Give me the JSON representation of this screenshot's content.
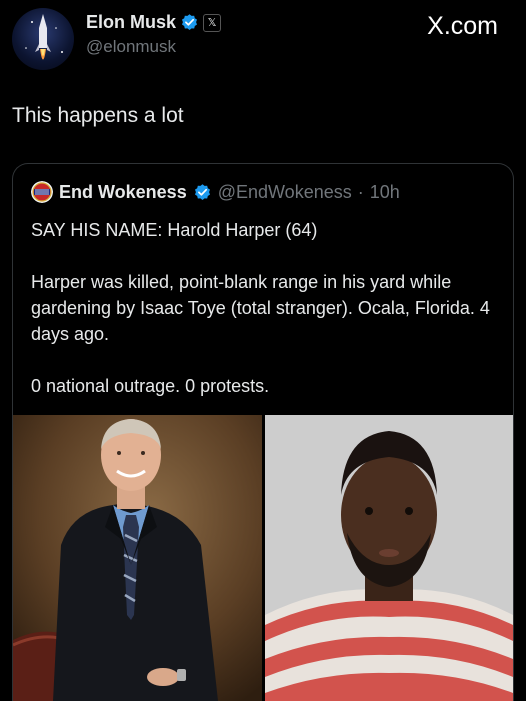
{
  "tweet": {
    "author_name": "Elon Musk",
    "author_handle": "@elonmusk",
    "text": "This happens a lot"
  },
  "brand": {
    "label": "X.com"
  },
  "icons": {
    "verified": "verified-badge-icon",
    "affiliate": "x-affiliate-badge-icon",
    "affiliate_glyph": "𝕏"
  },
  "colors": {
    "background": "#000000",
    "text": "#e7e9ea",
    "secondary_text": "#71767b",
    "verified_blue": "#1d9bf0",
    "border": "#2f3336"
  },
  "quote": {
    "author_name": "End Wokeness",
    "author_handle": "@EndWokeness",
    "separator": "·",
    "time": "10h",
    "line1": "SAY HIS NAME: Harold Harper (64)",
    "line2": "Harper was killed, point-blank range in his yard while gardening by Isaac Toye (total stranger). Ocala, Florida. 4 days ago.",
    "line3": "0 national outrage. 0 protests."
  }
}
